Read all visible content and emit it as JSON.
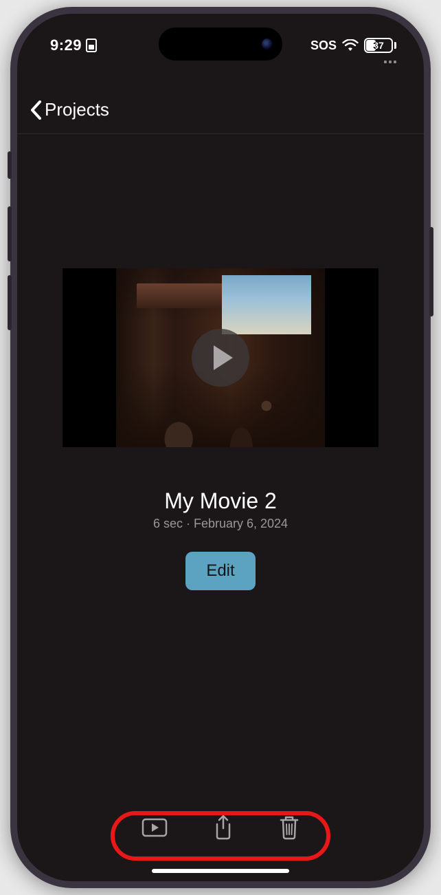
{
  "status": {
    "time": "9:29",
    "sos": "SOS",
    "battery": "37"
  },
  "nav": {
    "back_label": "Projects"
  },
  "project": {
    "title": "My Movie 2",
    "meta": "6 sec · February 6, 2024",
    "edit_label": "Edit"
  },
  "toolbar": {
    "play_name": "play-video-icon",
    "share_name": "share-icon",
    "delete_name": "trash-icon"
  }
}
